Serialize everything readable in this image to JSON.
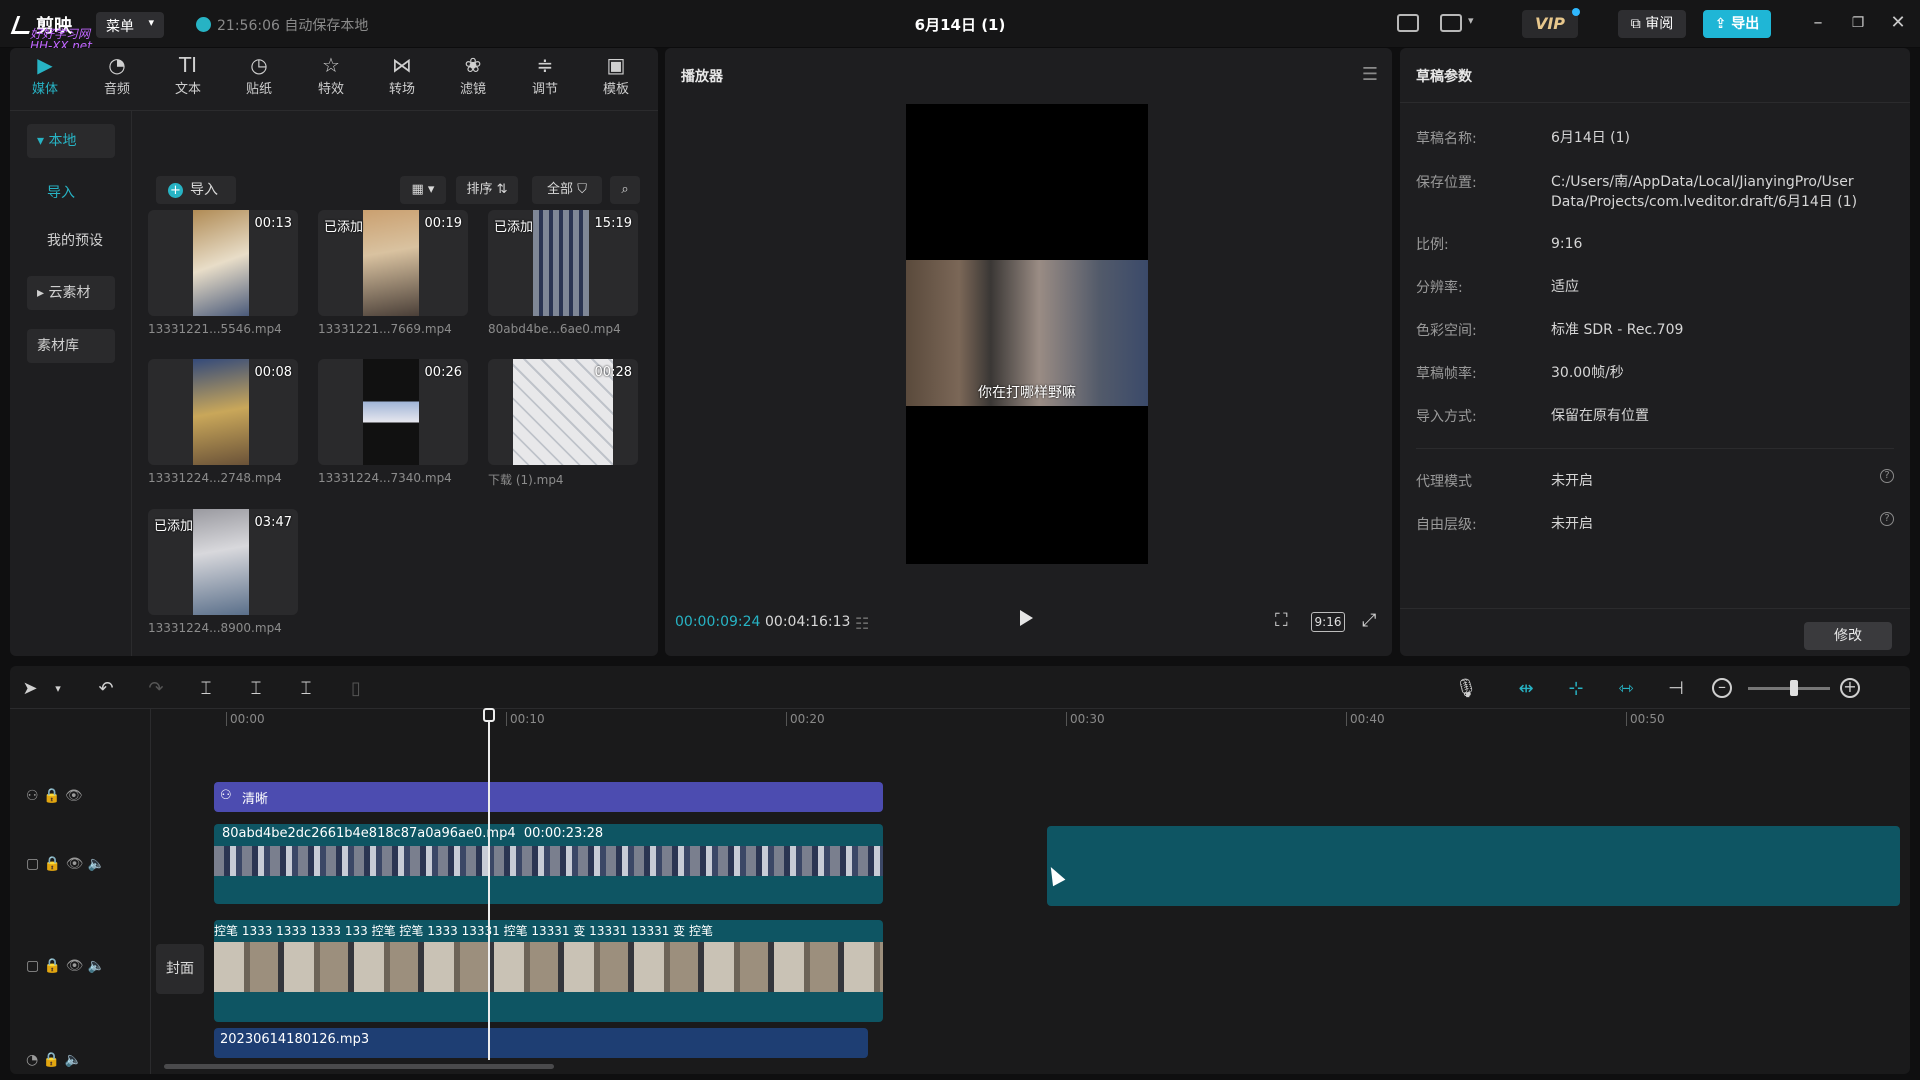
{
  "titlebar": {
    "app_name": "剪映",
    "watermark_line1": "好好学习网",
    "watermark_line2": "HH-XX.net",
    "menu_label": "菜单",
    "autosave_text": "21:56:06 自动保存本地",
    "doc_title": "6月14日 (1)",
    "vip_label": "VIP",
    "review_label": "审阅",
    "export_label": "导出"
  },
  "tooltabs": [
    {
      "label": "媒体",
      "icon": "▶"
    },
    {
      "label": "音频",
      "icon": "◔"
    },
    {
      "label": "文本",
      "icon": "TI"
    },
    {
      "label": "贴纸",
      "icon": "◷"
    },
    {
      "label": "特效",
      "icon": "☆"
    },
    {
      "label": "转场",
      "icon": "⋈"
    },
    {
      "label": "滤镜",
      "icon": "❀"
    },
    {
      "label": "调节",
      "icon": "≑"
    },
    {
      "label": "模板",
      "icon": "▣"
    }
  ],
  "media": {
    "nav": {
      "local": "本地",
      "import": "导入",
      "presets": "我的预设",
      "cloud": "云素材",
      "library": "素材库"
    },
    "import_button": "导入",
    "sort_label": "排序",
    "filter_label": "全部",
    "section_all": "全部",
    "items": [
      {
        "name": "13331221...5546.mp4",
        "duration": "00:13",
        "added": ""
      },
      {
        "name": "13331221...7669.mp4",
        "duration": "00:19",
        "added": "已添加"
      },
      {
        "name": "80abd4be...6ae0.mp4",
        "duration": "15:19",
        "added": "已添加"
      },
      {
        "name": "13331224...2748.mp4",
        "duration": "00:08",
        "added": ""
      },
      {
        "name": "13331224...7340.mp4",
        "duration": "00:26",
        "added": ""
      },
      {
        "name": "下载 (1).mp4",
        "duration": "00:28",
        "added": ""
      },
      {
        "name": "13331224...8900.mp4",
        "duration": "03:47",
        "added": "已添加"
      }
    ]
  },
  "player": {
    "title": "播放器",
    "subtitle": "你在打哪样野嘛",
    "current_time": "00:00:09:24",
    "total_time": "00:04:16:13",
    "ratio": "9:16"
  },
  "props": {
    "title": "草稿参数",
    "rows": [
      {
        "key": "草稿名称:",
        "value": "6月14日 (1)"
      },
      {
        "key": "保存位置:",
        "value": "C:/Users/南/AppData/Local/JianyingPro/User Data/Projects/com.lveditor.draft/6月14日 (1)"
      },
      {
        "key": "比例:",
        "value": "9:16"
      },
      {
        "key": "分辨率:",
        "value": "适应"
      },
      {
        "key": "色彩空间:",
        "value": "标准 SDR - Rec.709"
      },
      {
        "key": "草稿帧率:",
        "value": "30.00帧/秒"
      },
      {
        "key": "导入方式:",
        "value": "保留在原有位置"
      },
      {
        "key": "代理模式",
        "value": "未开启"
      },
      {
        "key": "自由层级:",
        "value": "未开启"
      }
    ],
    "modify_label": "修改"
  },
  "timeline": {
    "ruler": [
      "00:00",
      "00:10",
      "00:20",
      "00:30",
      "00:40",
      "00:50"
    ],
    "filter_clip": "清晰",
    "video_clip_name": "80abd4be2dc2661b4e818c87a0a96ae0.mp4",
    "video_clip_duration": "00:00:23:28",
    "main_clip_labels": "控笔 1333 1333 1333 133 控笔 控笔 1333 13331 控笔 13331 变 13331 13331 变 控笔",
    "cover_label": "封面",
    "audio_clip_name": "20230614180126.mp3"
  }
}
